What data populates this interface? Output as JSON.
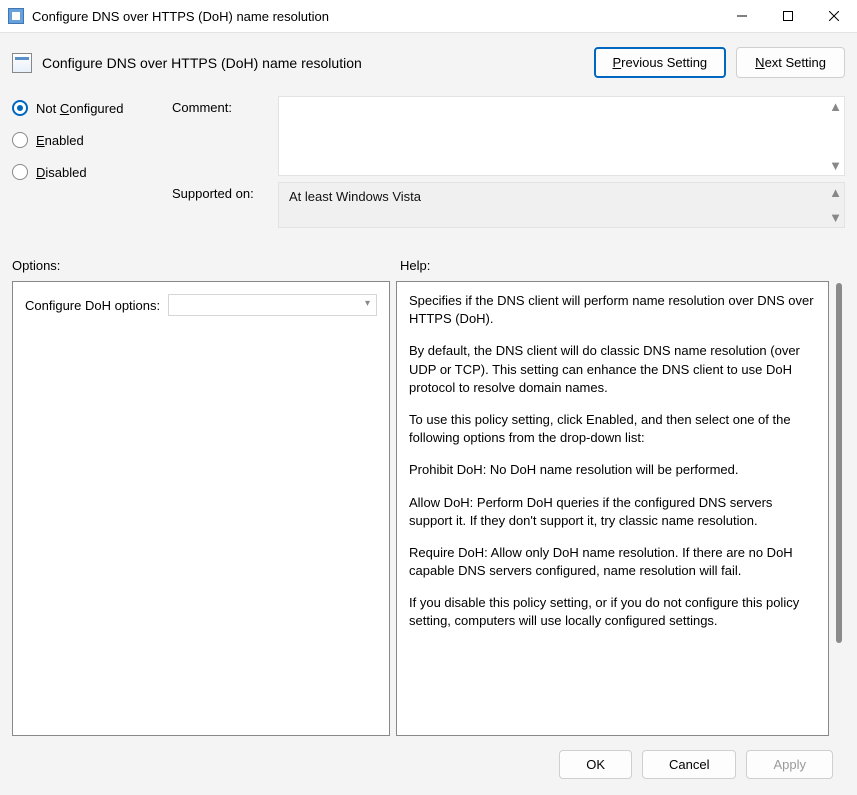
{
  "window": {
    "title": "Configure DNS over HTTPS (DoH) name resolution"
  },
  "header": {
    "title": "Configure DNS over HTTPS (DoH) name resolution",
    "prev_prefix": "P",
    "prev_suffix": "revious Setting",
    "next_prefix": "N",
    "next_suffix": "ext Setting"
  },
  "radios": {
    "not_configured_prefix": "Not ",
    "not_configured_ul": "C",
    "not_configured_suffix": "onfigured",
    "enabled_ul": "E",
    "enabled_suffix": "nabled",
    "disabled_ul": "D",
    "disabled_suffix": "isabled"
  },
  "meta": {
    "comment_label": "Comment:",
    "comment_value": "",
    "supported_label": "Supported on:",
    "supported_value": "At least Windows Vista"
  },
  "sections": {
    "options": "Options:",
    "help": "Help:"
  },
  "options": {
    "configure_doh_label": "Configure DoH options:",
    "configure_doh_value": ""
  },
  "help": {
    "p1": "Specifies if the DNS client will perform name resolution over DNS over HTTPS (DoH).",
    "p2": "By default, the DNS client will do classic DNS name resolution (over UDP or TCP). This setting can enhance the DNS client to use DoH protocol to resolve domain names.",
    "p3": "To use this policy setting, click Enabled, and then select one of the following options from the drop-down list:",
    "p4": "Prohibit DoH: No DoH name resolution will be performed.",
    "p5": "Allow DoH: Perform DoH queries if the configured DNS servers support it. If they don't support it, try classic name resolution.",
    "p6": "Require DoH: Allow only DoH name resolution. If there are no DoH capable DNS servers configured, name resolution will fail.",
    "p7": "If you disable this policy setting, or if you do not configure this policy setting, computers will use locally configured settings."
  },
  "footer": {
    "ok": "OK",
    "cancel": "Cancel",
    "apply": "Apply"
  }
}
